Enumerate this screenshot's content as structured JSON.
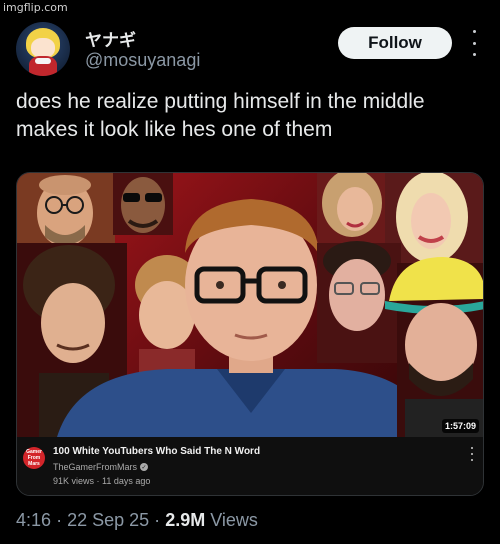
{
  "watermark": "imgflip.com",
  "author": {
    "display_name": "ヤナギ",
    "handle": "@mosuyanagi"
  },
  "follow_label": "Follow",
  "tweet_text": "does he realize putting himself in the middle makes it look like hes one of them",
  "video": {
    "duration": "1:57:09",
    "channel_avatar_text": "Gamer From Mars",
    "title": "100 White YouTubers Who Said The N Word",
    "channel": "TheGamerFromMars",
    "meta": "91K views · 11 days ago"
  },
  "post_meta": {
    "time": "4:16",
    "separator": "·",
    "date": "22 Sep 25",
    "views_count": "2.9M",
    "views_label": "Views"
  },
  "colors": {
    "background": "#000000",
    "follow_button": "#eff3f4",
    "thumbnail_red": "#b0171d",
    "secondary_text": "#8b98a5"
  }
}
